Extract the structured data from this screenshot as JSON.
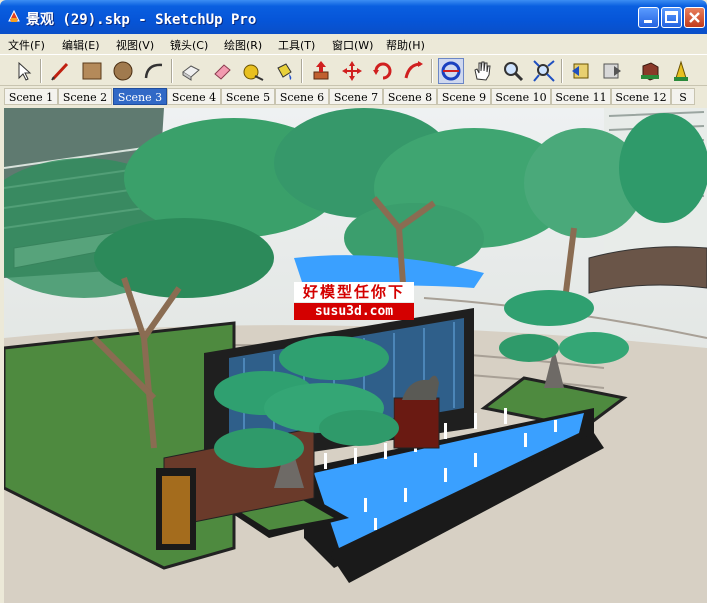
{
  "window": {
    "title": "景观 (29).skp - SketchUp Pro",
    "buttons": [
      "minimize",
      "maximize",
      "close"
    ]
  },
  "menubar": {
    "items": [
      "文件(F)",
      "编辑(E)",
      "视图(V)",
      "镜头(C)",
      "绘图(R)",
      "工具(T)",
      "窗口(W)",
      "帮助(H)"
    ]
  },
  "toolbar": {
    "tools": [
      "select-arrow-icon",
      "pencil-line-icon",
      "rectangle-icon",
      "circle-icon",
      "arc-icon",
      "make-component-icon",
      "eraser-icon",
      "tape-measure-icon",
      "paint-bucket-icon",
      "push-pull-icon",
      "move-icon",
      "rotate-icon",
      "follow-me-icon",
      "orbit-icon",
      "pan-hand-icon",
      "zoom-icon",
      "zoom-extents-icon",
      "previous-view-icon",
      "next-view-icon",
      "get-models-icon",
      "share-model-icon"
    ],
    "active_tool": "orbit-icon"
  },
  "scenes": {
    "tabs": [
      "Scene 1",
      "Scene 2",
      "Scene 3",
      "Scene 4",
      "Scene 5",
      "Scene 6",
      "Scene 7",
      "Scene 8",
      "Scene 9",
      "Scene 10",
      "Scene 11",
      "Scene 12",
      "S"
    ],
    "active": "Scene 3"
  },
  "viewport": {
    "watermark_line1": "好模型任你下",
    "watermark_line2": "susu3d.com"
  },
  "colors": {
    "titlebar": "#0655d8",
    "active_tab": "#3169c6",
    "water": "#3aa0ff",
    "lawn": "#4e8a3f",
    "tree_foliage": "#2f9a6a",
    "watermark_red": "#d40000"
  }
}
